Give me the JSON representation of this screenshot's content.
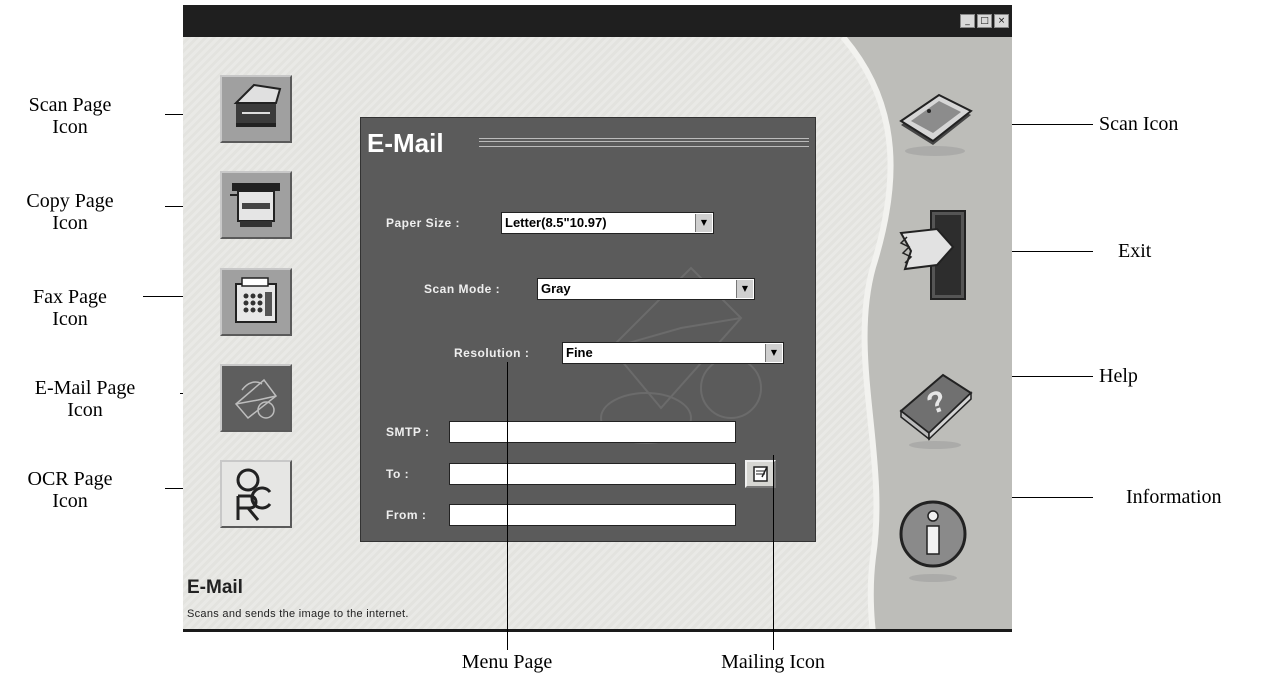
{
  "callouts": {
    "scan_page_icon": "Scan Page\nIcon",
    "copy_page_icon": "Copy Page\nIcon",
    "fax_page_icon": "Fax  Page\nIcon",
    "email_page_icon": "E-Mail Page\nIcon",
    "ocr_page_icon": "OCR Page\nIcon",
    "scan_icon": "Scan Icon",
    "exit": "Exit",
    "help": "Help",
    "information": "Information",
    "menu_page": "Menu Page",
    "mailing_icon": "Mailing Icon"
  },
  "window": {
    "controls": {
      "minimize": "_",
      "maximize": "□",
      "close": "×"
    }
  },
  "sidebar": {
    "items": [
      {
        "id": "scan",
        "icon": "scanner-icon"
      },
      {
        "id": "copy",
        "icon": "copier-icon"
      },
      {
        "id": "fax",
        "icon": "fax-icon"
      },
      {
        "id": "email",
        "icon": "email-icon",
        "active": true
      },
      {
        "id": "ocr",
        "icon": "ocr-icon"
      }
    ]
  },
  "panel": {
    "title": "E-Mail",
    "paper_size": {
      "label": "Paper Size :",
      "value": "Letter(8.5\"10.97)"
    },
    "scan_mode": {
      "label": "Scan Mode :",
      "value": "Gray"
    },
    "resolution": {
      "label": "Resolution :",
      "value": "Fine"
    },
    "smtp": {
      "label": "SMTP :",
      "value": ""
    },
    "to": {
      "label": "To :",
      "value": ""
    },
    "from": {
      "label": "From :",
      "value": ""
    }
  },
  "status": {
    "title": "E-Mail",
    "description": "Scans and sends the image to the internet."
  },
  "tools": [
    "scan-icon",
    "exit-icon",
    "help-icon",
    "info-icon"
  ],
  "colors": {
    "panel": "#5b5b5b",
    "titlebar": "#1f1f1f",
    "active_icon": "#5e5e5e"
  }
}
